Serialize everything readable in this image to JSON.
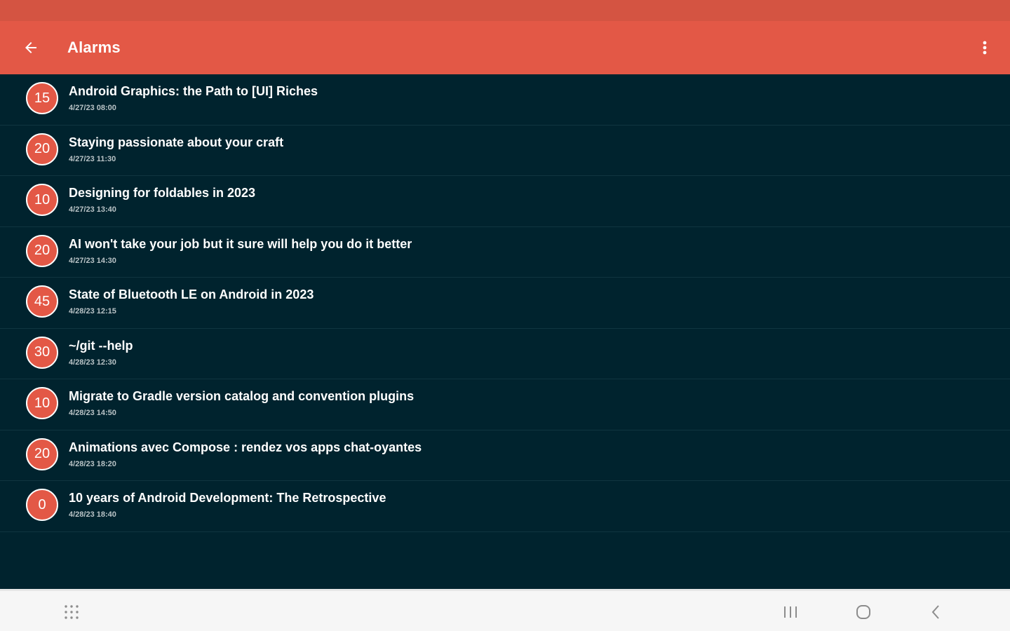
{
  "app_bar": {
    "title": "Alarms",
    "back_icon": "arrow-left-icon",
    "overflow_icon": "more-vert-icon"
  },
  "colors": {
    "status_bar": "#d45442",
    "app_bar": "#e35846",
    "background": "#00232e",
    "badge": "#e35846",
    "nav_bar": "#f6f6f6"
  },
  "alarms": [
    {
      "minutes": "15",
      "title": "Android Graphics: the Path to [UI] Riches",
      "time": "4/27/23 08:00"
    },
    {
      "minutes": "20",
      "title": "Staying passionate about your craft",
      "time": "4/27/23 11:30"
    },
    {
      "minutes": "10",
      "title": "Designing for foldables in 2023",
      "time": "4/27/23 13:40"
    },
    {
      "minutes": "20",
      "title": "AI won't take your job but it sure will help you do it better",
      "time": "4/27/23 14:30"
    },
    {
      "minutes": "45",
      "title": "State of Bluetooth LE on Android in 2023",
      "time": "4/28/23 12:15"
    },
    {
      "minutes": "30",
      "title": "~/git --help",
      "time": "4/28/23 12:30"
    },
    {
      "minutes": "10",
      "title": "Migrate to Gradle version catalog and convention plugins",
      "time": "4/28/23 14:50"
    },
    {
      "minutes": "20",
      "title": "Animations avec Compose : rendez vos apps chat-oyantes",
      "time": "4/28/23 18:20"
    },
    {
      "minutes": "0",
      "title": "10 years of Android Development: The Retrospective",
      "time": "4/28/23 18:40"
    }
  ],
  "nav_bar": {
    "apps_icon": "app-grid-icon",
    "recents_icon": "recents-icon",
    "home_icon": "home-icon",
    "back_icon": "nav-back-icon"
  }
}
